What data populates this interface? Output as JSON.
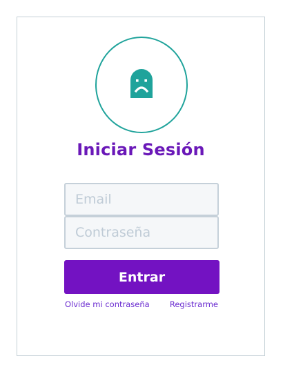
{
  "login": {
    "avatar_icon": "sad-ghost-icon",
    "accent_color": "#1fa39b",
    "title": "Iniciar Sesión",
    "email_placeholder": "Email",
    "password_placeholder": "Contraseña",
    "submit_label": "Entrar",
    "forgot_password": "Olvide mi contraseña",
    "register": "Registrarme",
    "brand_color": "#7312c2"
  }
}
